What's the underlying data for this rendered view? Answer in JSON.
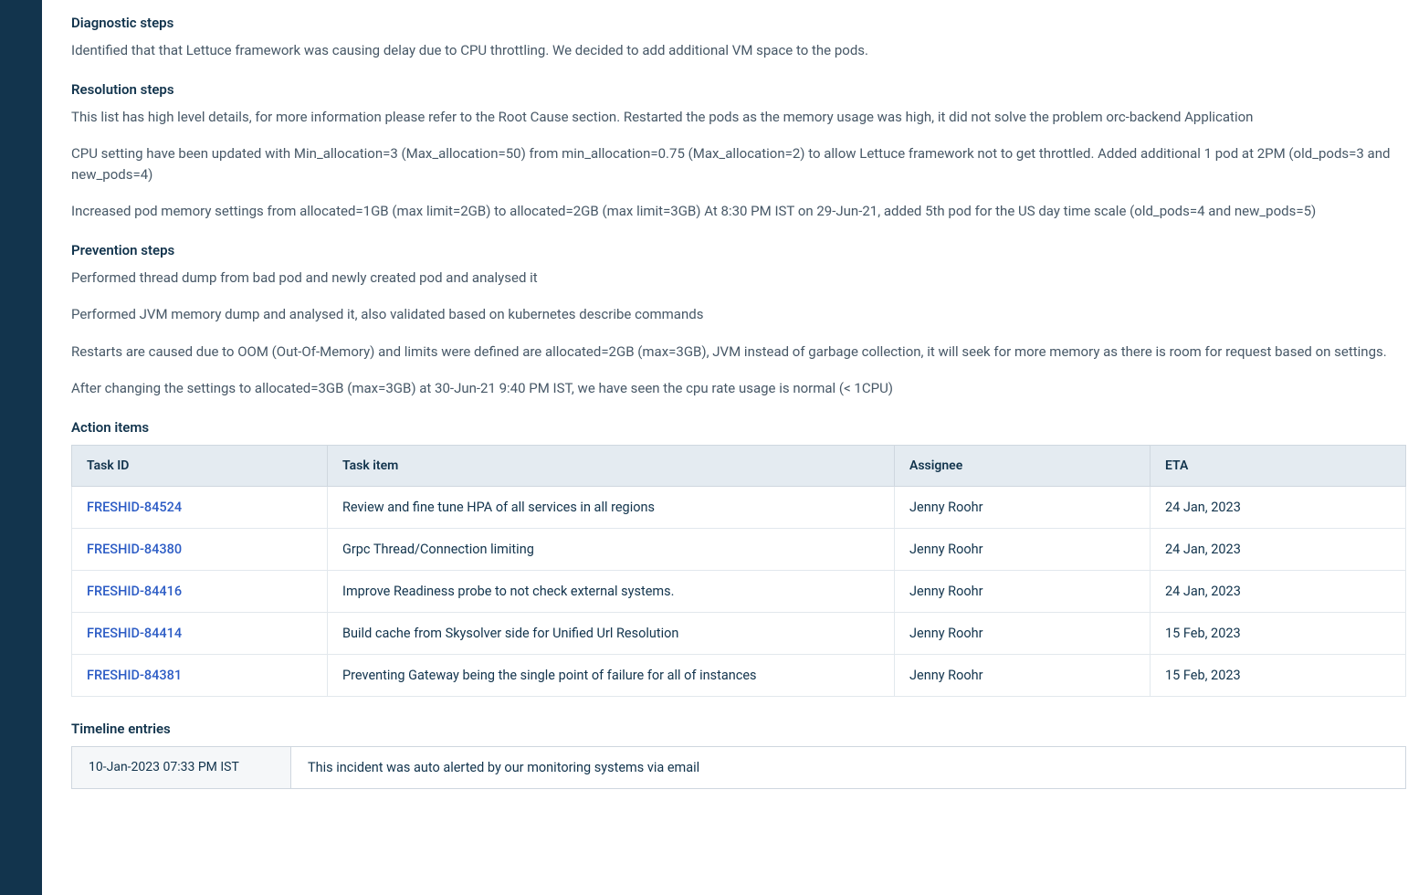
{
  "sections": {
    "diagnostic": {
      "heading": "Diagnostic steps",
      "paragraphs": [
        "Identified that that Lettuce framework was causing delay due to CPU throttling. We decided to add additional VM space to the pods."
      ]
    },
    "resolution": {
      "heading": "Resolution steps",
      "paragraphs": [
        "This list has high level details, for more information please refer to the Root Cause section. Restarted the pods as the memory usage was high, it did not solve the problem orc-backend Application",
        "CPU setting have been updated with Min_allocation=3 (Max_allocation=50) from min_allocation=0.75 (Max_allocation=2) to allow Lettuce framework not to get throttled. Added additional 1 pod at 2PM (old_pods=3 and new_pods=4)",
        "Increased pod memory settings from allocated=1GB (max limit=2GB) to allocated=2GB (max limit=3GB) At 8:30 PM IST on 29-Jun-21, added 5th pod for the US day time scale (old_pods=4 and new_pods=5)"
      ]
    },
    "prevention": {
      "heading": "Prevention steps",
      "paragraphs": [
        "Performed thread dump from bad pod and newly created pod and analysed it",
        "Performed JVM memory dump and analysed it, also validated based on kubernetes describe commands",
        "Restarts are caused due to OOM (Out-Of-Memory) and limits were defined are allocated=2GB (max=3GB), JVM instead of garbage collection, it will seek for more memory as there is room for request based on settings.",
        "After changing the settings to allocated=3GB (max=3GB) at 30-Jun-21 9:40 PM IST, we have seen the cpu rate usage is normal (< 1CPU)"
      ]
    },
    "action_items": {
      "heading": "Action items",
      "columns": [
        "Task ID",
        "Task item",
        "Assignee",
        "ETA"
      ],
      "rows": [
        {
          "task_id": "FRESHID-84524",
          "task_item": "Review and fine tune HPA of all services in all regions",
          "assignee": "Jenny Roohr",
          "eta": "24 Jan, 2023"
        },
        {
          "task_id": "FRESHID-84380",
          "task_item": "Grpc Thread/Connection limiting",
          "assignee": "Jenny Roohr",
          "eta": "24 Jan, 2023"
        },
        {
          "task_id": "FRESHID-84416",
          "task_item": "Improve Readiness probe to not check external systems.",
          "assignee": "Jenny Roohr",
          "eta": "24 Jan, 2023"
        },
        {
          "task_id": "FRESHID-84414",
          "task_item": "Build cache from Skysolver side for Unified Url Resolution",
          "assignee": "Jenny Roohr",
          "eta": "15 Feb, 2023"
        },
        {
          "task_id": "FRESHID-84381",
          "task_item": "Preventing Gateway being the single point of failure for all of instances",
          "assignee": "Jenny Roohr",
          "eta": "15 Feb, 2023"
        }
      ]
    },
    "timeline": {
      "heading": "Timeline entries",
      "rows": [
        {
          "ts": "10-Jan-2023 07:33 PM IST",
          "desc": "This incident was auto alerted by our monitoring systems via email"
        }
      ]
    }
  }
}
